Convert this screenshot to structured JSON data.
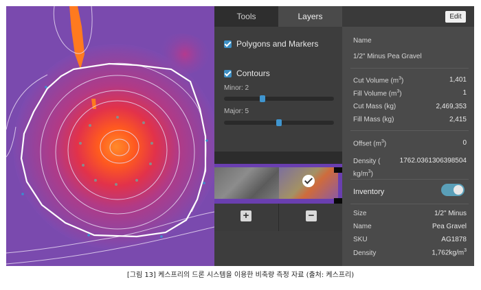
{
  "tabs": [
    {
      "label": "Tools",
      "active": false
    },
    {
      "label": "Layers",
      "active": true
    }
  ],
  "layers": {
    "polygons_label": "Polygons and Markers",
    "polygons_checked": true,
    "contours_label": "Contours",
    "contours_checked": true,
    "minor_label": "Minor: 2",
    "minor_level": 0.34,
    "major_label": "Major: 5",
    "major_level": 0.5
  },
  "image_buttons": {
    "add": "+",
    "remove": "−"
  },
  "details": {
    "edit_label": "Edit",
    "name_header": "Name",
    "name_value": "1/2\" Minus Pea Gravel",
    "cut_volume_label": "Cut Volume (m",
    "cut_volume_value": "1,401",
    "fill_volume_label": "Fill Volume (m",
    "fill_volume_value": "1",
    "cut_mass_label": "Cut Mass (kg)",
    "cut_mass_value": "2,469,353",
    "fill_mass_label": "Fill Mass (kg)",
    "fill_mass_value": "2,415",
    "offset_label": "Offset (m",
    "offset_value": "0",
    "density_label_a": "Density (",
    "density_label_b": "kg/m",
    "density_value": "1762.0361306398504",
    "cube_sup": "3",
    "close_paren": ")"
  },
  "inventory": {
    "title": "Inventory",
    "enabled": true,
    "size_label": "Size",
    "size_value": "1/2\" Minus",
    "name_label": "Name",
    "name_value": "Pea Gravel",
    "sku_label": "SKU",
    "sku_value": "AG1878",
    "density_label": "Density",
    "density_value": "1,762kg/m"
  },
  "caption": "[그림 13] 케스프리의 드론 시스템을 이용한 비축량 측정 자료 (출처: 케스프리)",
  "colors": {
    "accent": "#3f95cf",
    "toggle_on": "#5a9fb8",
    "map_purple": "#7c4bb0",
    "hotspot": "#ff5a1f"
  }
}
